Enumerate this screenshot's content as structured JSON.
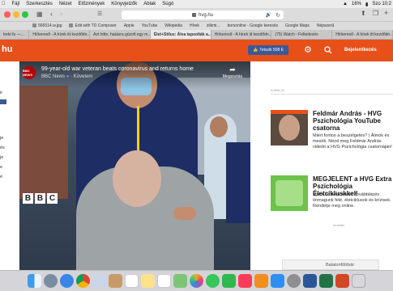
{
  "menubar": {
    "apple": "",
    "items": [
      "Fájl",
      "Szerkesztés",
      "Nézet",
      "Előzmények",
      "Könyvjelzők",
      "Ablak",
      "Súgó"
    ],
    "app": "",
    "battery": "16%",
    "clock": "Szo 10:2"
  },
  "toolbar": {
    "url": "hvg.hu"
  },
  "bookmarks": [
    "566514.w.jpg",
    "Edit with TD Composer",
    "Apple",
    "YouTube",
    "Wikipédia",
    "Hírek",
    "zilkmi...",
    "borsonline - Google keresés",
    "Google Maps",
    "Népszerű"
  ],
  "tabs": [
    {
      "label": "trekt fu —..."
    },
    {
      "label": "Hírkereső - A hírek itt kezdődn..."
    },
    {
      "label": "Azt hitte, hatásra gúzolt egy m..."
    },
    {
      "label": "Élet+Stílus: Álva tapsolták a...",
      "active": true
    },
    {
      "label": "Hírkereső - A hírek itt kezdődn..."
    },
    {
      "label": "(75) Watch - Feltedezés"
    },
    {
      "label": "Hírkereső - A hírek itt kezdődn..."
    }
  ],
  "header": {
    "logo": "hu",
    "fb_button": "Tetszik 508 E",
    "login": "Bejelentkezés"
  },
  "left_strip": {
    "labels": [
      "ir",
      "je",
      "és",
      "je",
      "e",
      "é"
    ]
  },
  "video": {
    "title": "99-year-old war veteran beats coronavirus and returns home",
    "channel": "BBC News",
    "follow": "Követem",
    "share": "Megosztás",
    "avatar": "BBC NEWS",
    "bbc": [
      "B",
      "B",
      "C"
    ]
  },
  "sidebar": {
    "ad_label": "AJÁNLAT",
    "cards": [
      {
        "title": "Feldmár András - HVG Pszichológia YouTube csatorna",
        "desc": "Miért fontos a beszélgetés? | Álmok és mesék. Nézd meg Feldmár András videóit a HVG Pszichológia csatornáján!"
      },
      {
        "title": "MEGJELENT a HVG Extra Pszichológia Életcikluskkel!",
        "desc": "Mikor ha nem most? Továbblépés önmagunk felé, életciklusok és krízisek. Rendelje meg online."
      }
    ],
    "hirdetes": "hirdetés",
    "bottom_ad": "Balatonföldvár"
  },
  "dock": {
    "apps": [
      "finder",
      "launchpad",
      "safari",
      "chrome",
      "mail",
      "contacts",
      "calendar",
      "notes",
      "reminders",
      "maps",
      "photos",
      "messages",
      "facetime",
      "music",
      "books",
      "app-store",
      "preferences",
      "word",
      "excel",
      "powerpoint",
      "trash"
    ]
  },
  "colors": {
    "brand": "#e8501a",
    "facebook": "#3b5998"
  }
}
